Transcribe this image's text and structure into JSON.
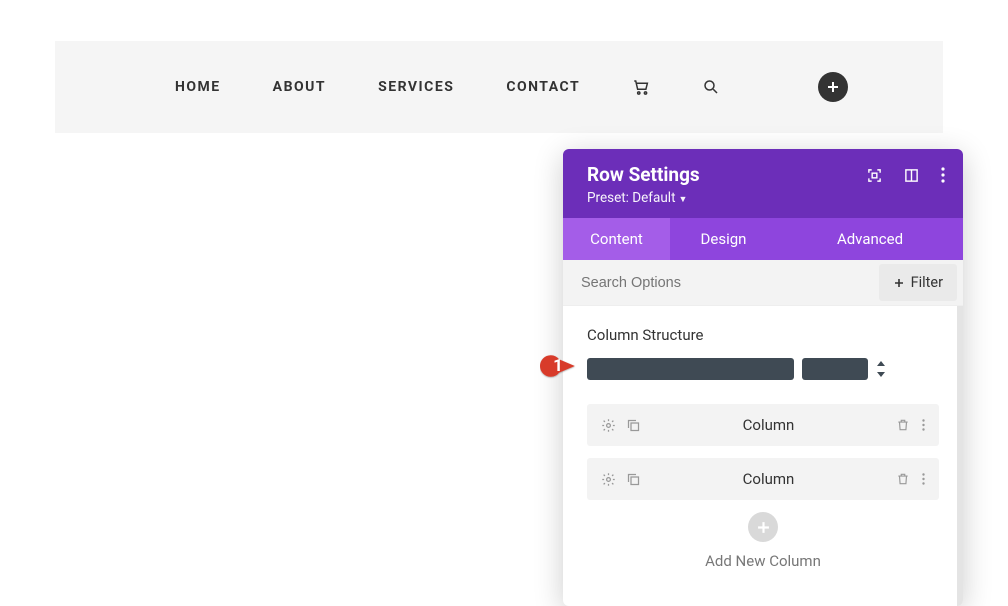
{
  "nav": {
    "items": [
      "HOME",
      "ABOUT",
      "SERVICES",
      "CONTACT"
    ]
  },
  "panel": {
    "title": "Row Settings",
    "preset_label": "Preset: Default",
    "tabs": [
      "Content",
      "Design",
      "Advanced"
    ],
    "active_tab": 0,
    "search_placeholder": "Search Options",
    "filter_label": "Filter",
    "section_label": "Column Structure",
    "columns": [
      {
        "label": "Column"
      },
      {
        "label": "Column"
      }
    ],
    "add_column_label": "Add New Column"
  },
  "annotation": {
    "number": "1"
  },
  "colors": {
    "purple_dark": "#6c2eb9",
    "purple_mid": "#8e45dd",
    "purple_light": "#a45de8",
    "annotation_red": "#d83a2a"
  }
}
